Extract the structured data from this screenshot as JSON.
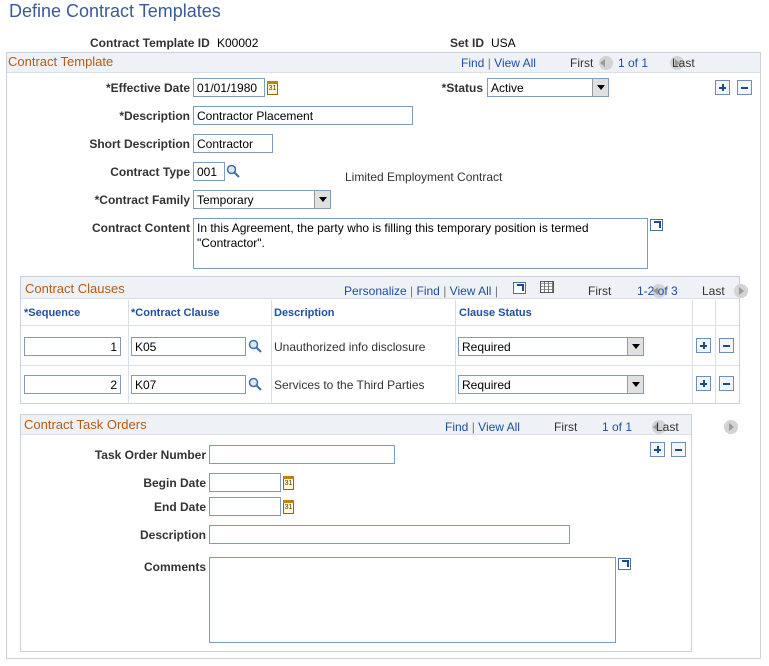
{
  "page": {
    "title": "Define Contract Templates"
  },
  "key": {
    "template_id_label": "Contract Template ID",
    "template_id_value": "K00002",
    "setid_label": "Set ID",
    "setid_value": "USA"
  },
  "template_group": {
    "title": "Contract Template",
    "nav": {
      "find": "Find",
      "sep": "|",
      "view_all": "View All",
      "first": "First",
      "range": "1 of 1",
      "last": "Last"
    },
    "effective_date_label": "*Effective Date",
    "effective_date_value": "01/01/1980",
    "status_label": "*Status",
    "status_value": "Active",
    "description_label": "*Description",
    "description_value": "Contractor Placement",
    "short_description_label": "Short Description",
    "short_description_value": "Contractor",
    "contract_type_label": "Contract Type",
    "contract_type_value": "001",
    "contract_type_desc": "Limited Employment Contract",
    "contract_family_label": "*Contract Family",
    "contract_family_value": "Temporary",
    "contract_content_label": "Contract Content",
    "contract_content_value": "In this Agreement, the party who is filling this temporary position is termed \"Contractor\"."
  },
  "clauses": {
    "title": "Contract Clauses",
    "nav": {
      "personalize": "Personalize",
      "find": "Find",
      "view_all": "View All",
      "sep": "|",
      "first": "First",
      "range": "1-2 of 3",
      "last": "Last"
    },
    "headers": {
      "sequence": "*Sequence",
      "clause": "*Contract Clause",
      "description": "Description",
      "status": "Clause Status"
    },
    "rows": [
      {
        "sequence": "1",
        "clause": "K05",
        "description": "Unauthorized info disclosure",
        "status": "Required"
      },
      {
        "sequence": "2",
        "clause": "K07",
        "description": "Services to the Third Parties",
        "status": "Required"
      }
    ]
  },
  "task_orders": {
    "title": "Contract Task Orders",
    "nav": {
      "find": "Find",
      "sep": "|",
      "view_all": "View All",
      "first": "First",
      "range": "1 of 1",
      "last": "Last"
    },
    "task_order_number_label": "Task Order Number",
    "task_order_number_value": "",
    "begin_date_label": "Begin Date",
    "begin_date_value": "",
    "end_date_label": "End Date",
    "end_date_value": "",
    "description_label": "Description",
    "description_value": "",
    "comments_label": "Comments",
    "comments_value": ""
  },
  "icons": {
    "calendar": "calendar-icon",
    "lookup": "magnifier-lookup-icon",
    "add_row": "add-row-icon",
    "delete_row": "delete-row-icon",
    "expand": "expand-field-icon",
    "download": "spreadsheet-download-icon"
  }
}
